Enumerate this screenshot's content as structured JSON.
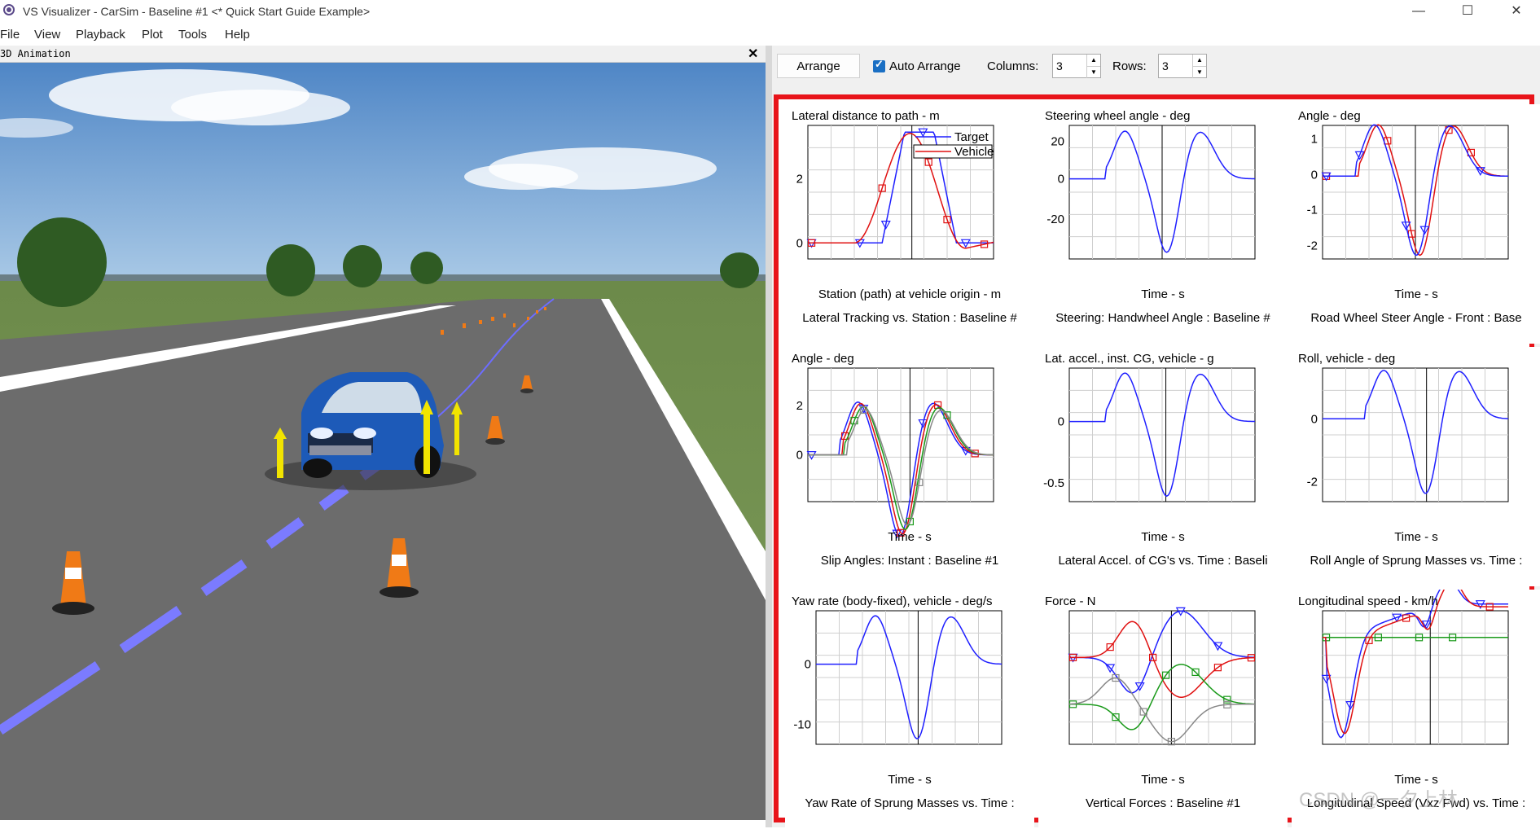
{
  "window": {
    "title": "VS Visualizer - CarSim - Baseline #1 <* Quick Start Guide Example>",
    "minimize": "—",
    "maximize": "☐",
    "close": "✕"
  },
  "menu": [
    "File",
    "View",
    "Playback",
    "Plot",
    "Tools",
    "Help"
  ],
  "animation": {
    "title": "3D Animation",
    "close": "✕"
  },
  "toolbar": {
    "arrange_label": "Arrange",
    "auto_arrange_label": "Auto Arrange",
    "auto_arrange_checked": true,
    "columns_label": "Columns:",
    "columns_value": "3",
    "rows_label": "Rows:",
    "rows_value": "3"
  },
  "colors": {
    "frame": "#e8141a",
    "series_blue": "#1f1fff",
    "series_red": "#e01010",
    "series_green": "#1a9a1a",
    "series_gray": "#888888"
  },
  "watermark": "CSDN @一夕上林",
  "plots": [
    {
      "ylabel": "Lateral distance to path - m",
      "xlabel": "Station (path) at vehicle origin - m",
      "title": "Lateral Tracking vs. Station : Baseline #",
      "yticks": [
        "2",
        "0"
      ],
      "legend": [
        "Target",
        "Vehicle"
      ]
    },
    {
      "ylabel": "Steering wheel angle - deg",
      "xlabel": "Time - s",
      "title": "Steering: Handwheel Angle : Baseline #",
      "yticks": [
        "20",
        "0",
        "-20"
      ]
    },
    {
      "ylabel": "Angle - deg",
      "xlabel": "Time - s",
      "title": "Road Wheel Steer Angle - Front : Base",
      "yticks": [
        "1",
        "0",
        "-1",
        "-2"
      ]
    },
    {
      "ylabel": "Angle - deg",
      "xlabel": "Time - s",
      "title": "Slip Angles: Instant : Baseline #1",
      "yticks": [
        "2",
        "0"
      ]
    },
    {
      "ylabel": "Lat. accel., inst. CG, vehicle - g",
      "xlabel": "Time - s",
      "title": "Lateral Accel. of CG's vs. Time : Baseli",
      "yticks": [
        "0",
        "-0.5"
      ]
    },
    {
      "ylabel": "Roll, vehicle - deg",
      "xlabel": "Time - s",
      "title": "Roll Angle of Sprung Masses vs. Time :",
      "yticks": [
        "0",
        "-2"
      ]
    },
    {
      "ylabel": "Yaw rate (body-fixed), vehicle - deg/s",
      "xlabel": "Time - s",
      "title": "Yaw Rate of Sprung Masses vs. Time :",
      "yticks": [
        "0",
        "-10"
      ]
    },
    {
      "ylabel": "Force - N",
      "xlabel": "Time - s",
      "title": "Vertical Forces : Baseline #1",
      "yticks": []
    },
    {
      "ylabel": "Longitudinal speed - km/h",
      "xlabel": "Time - s",
      "title": "Longitudinal Speed (Vxz Fwd) vs. Time :",
      "yticks": []
    }
  ]
}
